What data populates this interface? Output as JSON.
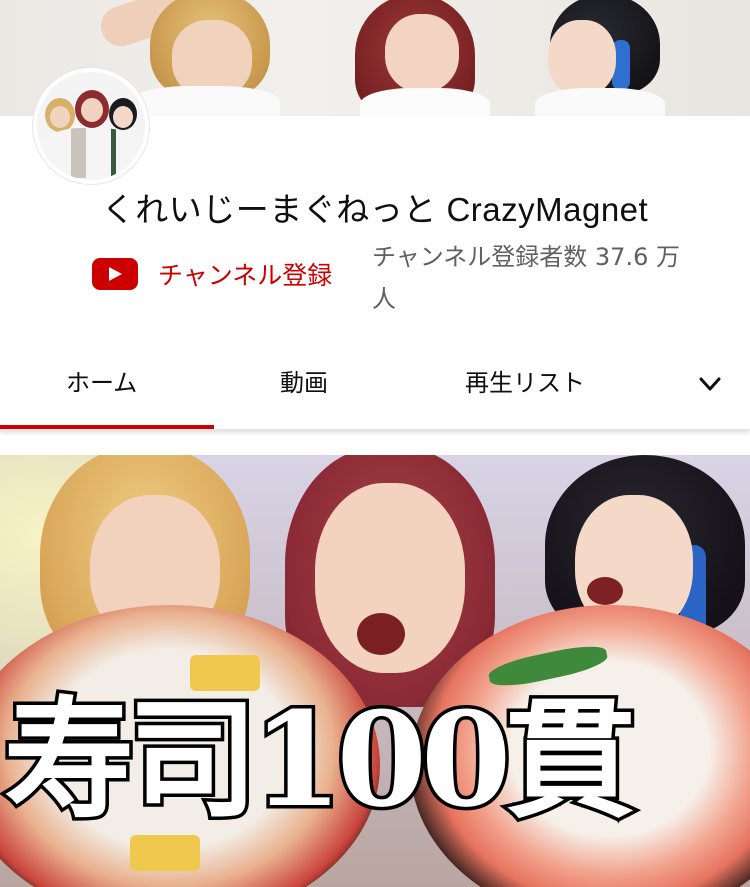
{
  "channel": {
    "name": "くれいじーまぐねっと CrazyMagnet",
    "subscribe_label": "チャンネル登録",
    "subscriber_count": "チャンネル登録者数 37.6 万人"
  },
  "tabs": [
    {
      "label": "ホーム",
      "selected": true
    },
    {
      "label": "動画",
      "selected": false
    },
    {
      "label": "再生リスト",
      "selected": false
    }
  ],
  "featured_video": {
    "thumbnail_text": "寿司100貫"
  },
  "colors": {
    "accent": "#cc0000",
    "text_primary": "#0f0f0f",
    "text_secondary": "#606060"
  },
  "icons": {
    "subscribe": "youtube-play-icon",
    "more_tabs": "chevron-down-icon"
  }
}
